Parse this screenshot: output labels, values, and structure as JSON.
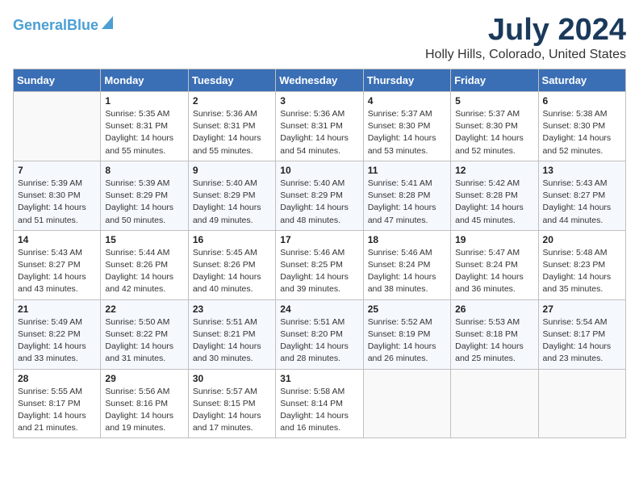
{
  "logo": {
    "part1": "General",
    "part2": "Blue"
  },
  "title": "July 2024",
  "subtitle": "Holly Hills, Colorado, United States",
  "days_header": [
    "Sunday",
    "Monday",
    "Tuesday",
    "Wednesday",
    "Thursday",
    "Friday",
    "Saturday"
  ],
  "weeks": [
    [
      {
        "day": "",
        "info": ""
      },
      {
        "day": "1",
        "info": "Sunrise: 5:35 AM\nSunset: 8:31 PM\nDaylight: 14 hours\nand 55 minutes."
      },
      {
        "day": "2",
        "info": "Sunrise: 5:36 AM\nSunset: 8:31 PM\nDaylight: 14 hours\nand 55 minutes."
      },
      {
        "day": "3",
        "info": "Sunrise: 5:36 AM\nSunset: 8:31 PM\nDaylight: 14 hours\nand 54 minutes."
      },
      {
        "day": "4",
        "info": "Sunrise: 5:37 AM\nSunset: 8:30 PM\nDaylight: 14 hours\nand 53 minutes."
      },
      {
        "day": "5",
        "info": "Sunrise: 5:37 AM\nSunset: 8:30 PM\nDaylight: 14 hours\nand 52 minutes."
      },
      {
        "day": "6",
        "info": "Sunrise: 5:38 AM\nSunset: 8:30 PM\nDaylight: 14 hours\nand 52 minutes."
      }
    ],
    [
      {
        "day": "7",
        "info": "Sunrise: 5:39 AM\nSunset: 8:30 PM\nDaylight: 14 hours\nand 51 minutes."
      },
      {
        "day": "8",
        "info": "Sunrise: 5:39 AM\nSunset: 8:29 PM\nDaylight: 14 hours\nand 50 minutes."
      },
      {
        "day": "9",
        "info": "Sunrise: 5:40 AM\nSunset: 8:29 PM\nDaylight: 14 hours\nand 49 minutes."
      },
      {
        "day": "10",
        "info": "Sunrise: 5:40 AM\nSunset: 8:29 PM\nDaylight: 14 hours\nand 48 minutes."
      },
      {
        "day": "11",
        "info": "Sunrise: 5:41 AM\nSunset: 8:28 PM\nDaylight: 14 hours\nand 47 minutes."
      },
      {
        "day": "12",
        "info": "Sunrise: 5:42 AM\nSunset: 8:28 PM\nDaylight: 14 hours\nand 45 minutes."
      },
      {
        "day": "13",
        "info": "Sunrise: 5:43 AM\nSunset: 8:27 PM\nDaylight: 14 hours\nand 44 minutes."
      }
    ],
    [
      {
        "day": "14",
        "info": "Sunrise: 5:43 AM\nSunset: 8:27 PM\nDaylight: 14 hours\nand 43 minutes."
      },
      {
        "day": "15",
        "info": "Sunrise: 5:44 AM\nSunset: 8:26 PM\nDaylight: 14 hours\nand 42 minutes."
      },
      {
        "day": "16",
        "info": "Sunrise: 5:45 AM\nSunset: 8:26 PM\nDaylight: 14 hours\nand 40 minutes."
      },
      {
        "day": "17",
        "info": "Sunrise: 5:46 AM\nSunset: 8:25 PM\nDaylight: 14 hours\nand 39 minutes."
      },
      {
        "day": "18",
        "info": "Sunrise: 5:46 AM\nSunset: 8:24 PM\nDaylight: 14 hours\nand 38 minutes."
      },
      {
        "day": "19",
        "info": "Sunrise: 5:47 AM\nSunset: 8:24 PM\nDaylight: 14 hours\nand 36 minutes."
      },
      {
        "day": "20",
        "info": "Sunrise: 5:48 AM\nSunset: 8:23 PM\nDaylight: 14 hours\nand 35 minutes."
      }
    ],
    [
      {
        "day": "21",
        "info": "Sunrise: 5:49 AM\nSunset: 8:22 PM\nDaylight: 14 hours\nand 33 minutes."
      },
      {
        "day": "22",
        "info": "Sunrise: 5:50 AM\nSunset: 8:22 PM\nDaylight: 14 hours\nand 31 minutes."
      },
      {
        "day": "23",
        "info": "Sunrise: 5:51 AM\nSunset: 8:21 PM\nDaylight: 14 hours\nand 30 minutes."
      },
      {
        "day": "24",
        "info": "Sunrise: 5:51 AM\nSunset: 8:20 PM\nDaylight: 14 hours\nand 28 minutes."
      },
      {
        "day": "25",
        "info": "Sunrise: 5:52 AM\nSunset: 8:19 PM\nDaylight: 14 hours\nand 26 minutes."
      },
      {
        "day": "26",
        "info": "Sunrise: 5:53 AM\nSunset: 8:18 PM\nDaylight: 14 hours\nand 25 minutes."
      },
      {
        "day": "27",
        "info": "Sunrise: 5:54 AM\nSunset: 8:17 PM\nDaylight: 14 hours\nand 23 minutes."
      }
    ],
    [
      {
        "day": "28",
        "info": "Sunrise: 5:55 AM\nSunset: 8:17 PM\nDaylight: 14 hours\nand 21 minutes."
      },
      {
        "day": "29",
        "info": "Sunrise: 5:56 AM\nSunset: 8:16 PM\nDaylight: 14 hours\nand 19 minutes."
      },
      {
        "day": "30",
        "info": "Sunrise: 5:57 AM\nSunset: 8:15 PM\nDaylight: 14 hours\nand 17 minutes."
      },
      {
        "day": "31",
        "info": "Sunrise: 5:58 AM\nSunset: 8:14 PM\nDaylight: 14 hours\nand 16 minutes."
      },
      {
        "day": "",
        "info": ""
      },
      {
        "day": "",
        "info": ""
      },
      {
        "day": "",
        "info": ""
      }
    ]
  ]
}
